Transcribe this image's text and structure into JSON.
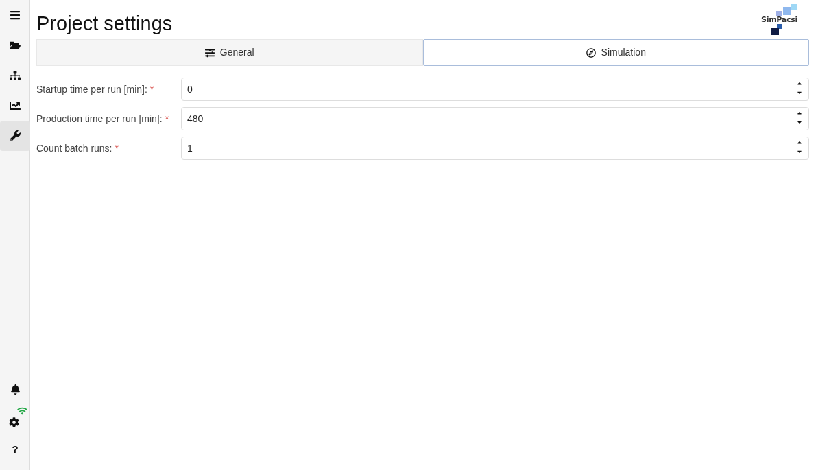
{
  "sidebar": {
    "items": [
      {
        "kind": "menu",
        "selected": false
      },
      {
        "kind": "folder",
        "selected": false
      },
      {
        "kind": "hierarchy",
        "selected": false
      },
      {
        "kind": "chart",
        "selected": false
      },
      {
        "kind": "wrench",
        "selected": true
      }
    ],
    "bottom_items": [
      {
        "kind": "bell"
      },
      {
        "kind": "connection"
      },
      {
        "kind": "help",
        "label": "?"
      }
    ]
  },
  "title": "Project settings",
  "logo": {
    "text": "SimPacsi"
  },
  "tabs": [
    {
      "label": "General",
      "kind": "sliders",
      "selected": false
    },
    {
      "label": "Simulation",
      "kind": "compass",
      "selected": true
    }
  ],
  "fields": [
    {
      "label": "Startup time per run [min]:",
      "required_mark": "*",
      "value": "0"
    },
    {
      "label": "Production time per run [min]:",
      "required_mark": "*",
      "value": "480"
    },
    {
      "label": "Count batch runs:",
      "required_mark": "*",
      "value": "1"
    }
  ]
}
